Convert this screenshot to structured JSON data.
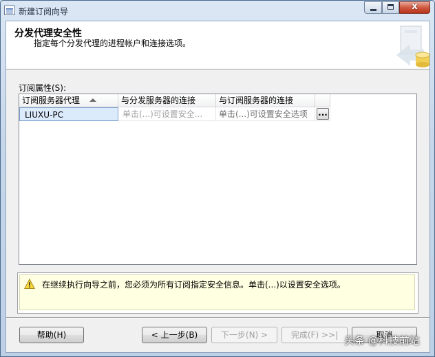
{
  "window": {
    "title": "新建订阅向导",
    "close_glyph": "x"
  },
  "header": {
    "title": "分发代理安全性",
    "subtitle": "指定每个分发代理的进程帐户和连接选项。"
  },
  "grid": {
    "caption": "订阅属性(S):",
    "columns": [
      "订阅服务器代理",
      "与分发服务器的连接",
      "与订阅服务器的连接"
    ],
    "rows": [
      {
        "agent": "LIUXU-PC",
        "distributor_conn": "单击(...)可设置安全...",
        "subscriber_conn": "单击(...)可设置安全选项",
        "button": "..."
      }
    ]
  },
  "message": {
    "text": "在继续执行向导之前，您必须为所有订阅指定安全信息。单击(...)以设置安全选项。"
  },
  "buttons": {
    "help": "帮助(H)",
    "back": "< 上一步(B)",
    "next": "下一步(N) >",
    "finish": "完成(F) >>|",
    "cancel": "取消"
  },
  "watermark": "头条 @科技前站",
  "colors": {
    "selected_row": "#dcebfc",
    "message_bg": "#ffffe1",
    "close_button": "#c8452c"
  }
}
